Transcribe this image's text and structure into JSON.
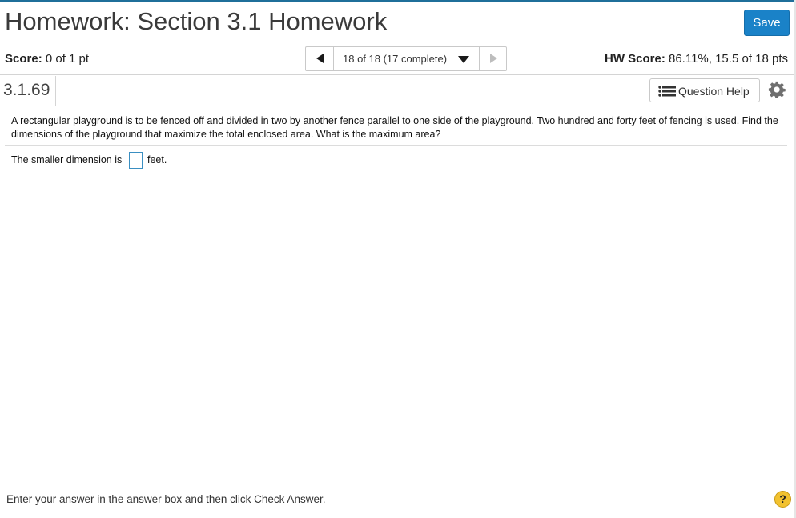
{
  "header": {
    "title": "Homework: Section 3.1 Homework",
    "save_label": "Save"
  },
  "score_bar": {
    "score_label": "Score:",
    "score_value": " 0 of 1 pt",
    "nav_label": "18 of 18 (17 complete)",
    "hw_score_label": "HW Score:",
    "hw_score_value": " 86.11%, 15.5 of 18 pts"
  },
  "question_bar": {
    "number": "3.1.69",
    "help_label": "Question Help"
  },
  "question": {
    "text": "A rectangular playground is to be fenced off and divided in two by another fence parallel to one side of the playground. Two hundred and forty feet of fencing is used. Find the dimensions of the playground that maximize the total enclosed area. What is the maximum area?",
    "answer_prefix": "The smaller dimension is",
    "answer_value": "",
    "answer_suffix": "feet."
  },
  "footer": {
    "instruction": "Enter your answer in the answer box and then click Check Answer.",
    "help_symbol": "?"
  },
  "icons": {
    "prev": "left-triangle-icon",
    "dropdown": "caret-down-icon",
    "next": "right-triangle-icon",
    "question_help": "list-icon",
    "settings": "gear-icon",
    "help": "help-icon"
  },
  "colors": {
    "accent_blue": "#1a82c8",
    "top_rule": "#1f6f9a",
    "help_yellow": "#f2c230"
  }
}
